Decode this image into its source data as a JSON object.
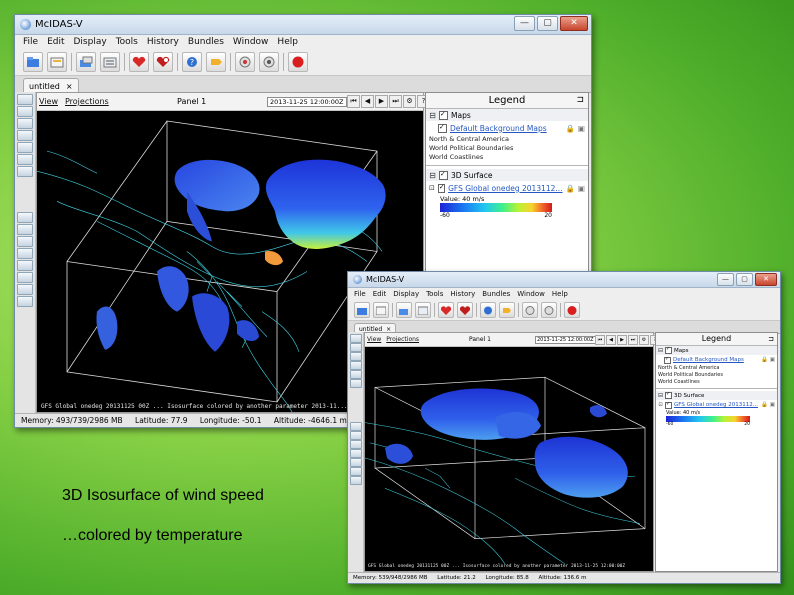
{
  "window": {
    "title": "McIDAS-V",
    "controls": {
      "minimize": "—",
      "maximize": "▢",
      "close": "✕"
    }
  },
  "menu": [
    "File",
    "Edit",
    "Display",
    "Tools",
    "History",
    "Bundles",
    "Window",
    "Help"
  ],
  "toolbar": {
    "icons": [
      "open-bundle-icon",
      "save-bundle-icon",
      "data-sources-icon",
      "field-selector-icon",
      "favorites-icon",
      "add-favorite-icon",
      "help-icon",
      "forward-icon",
      "cancel-icon",
      "refresh-icon",
      "stop-icon"
    ]
  },
  "tab": {
    "label": "untitled",
    "close": "×"
  },
  "panel": {
    "view_menu": "View",
    "projections_menu": "Projections",
    "title": "Panel 1"
  },
  "animation": {
    "back5_large": "2013-11-25 12:00:00Z",
    "front5_small": "2013-11-25 12:00:00Z",
    "buttons": [
      "⏮",
      "◀",
      "▶",
      "⏭",
      "⚙",
      "?"
    ]
  },
  "legend": {
    "title": "Legend",
    "groups": [
      {
        "name": "Maps",
        "layer": "Default Background Maps",
        "items": [
          "North & Central America",
          "World Political Boundaries",
          "World Coastlines"
        ]
      },
      {
        "name": "3D Surface",
        "layer_large": "GFS Global onedeg 2013112...",
        "layer_small": "GFS Global onedeg 2013112...",
        "value_label": "Value: 40 m/s",
        "scale_min": "-60",
        "scale_max": "20"
      }
    ]
  },
  "scene_labels": {
    "large": "GFS Global onedeg 20131125 00Z ... Isosurface colored by another parameter 2013-11...",
    "small": "GFS Global onedeg 20131125 00Z ... Isosurface colored by another parameter 2013-11-25 12:00:00Z"
  },
  "status": {
    "large": {
      "memory": "Memory: 493/739/2986 MB",
      "latitude": "Latitude: 77.9",
      "longitude": "Longitude: -50.1",
      "altitude": "Altitude: -4646.1 m"
    },
    "small": {
      "memory": "Memory: 539/948/2986 MB",
      "latitude": "Latitude: 21.2",
      "longitude": "Longitude: 85.8",
      "altitude": "Altitude: 136.6 m"
    }
  },
  "captions": {
    "line1": "3D Isosurface of wind speed",
    "line2": "…colored by temperature"
  },
  "colors": {
    "legend_link": "#2457c3",
    "scene_bg": "#000000",
    "coastline": "#3fd6e6",
    "iso_surface": "#2a52e6"
  }
}
